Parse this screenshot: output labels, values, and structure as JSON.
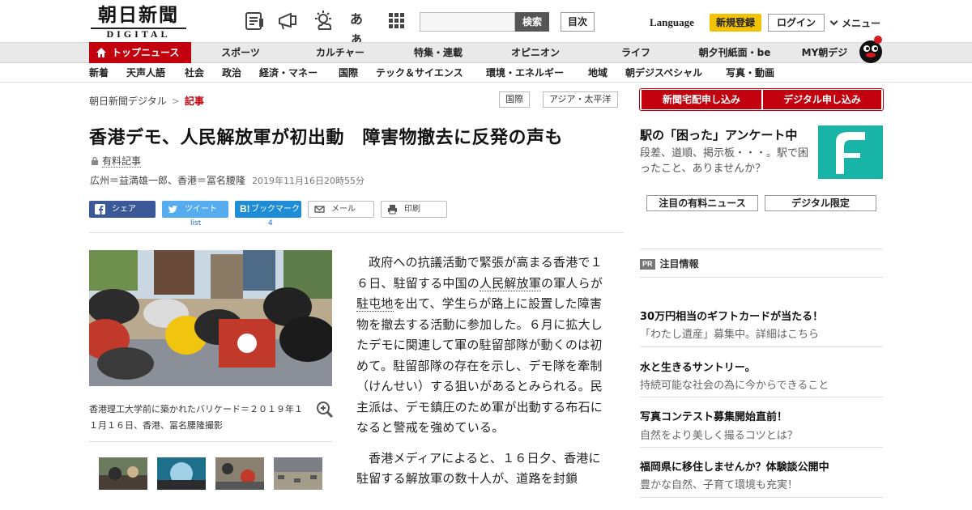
{
  "header": {
    "logo_ja": "朝日新聞",
    "logo_en": "DIGITAL",
    "search_placeholder": "",
    "search_button": "検索",
    "toc_button": "目次",
    "language": "Language",
    "register": "新規登録",
    "login": "ログイン",
    "menu": "メニュー",
    "icons": [
      "newspaper-icon",
      "megaphone-icon",
      "weather-icon",
      "font-size-icon",
      "grid-icon"
    ],
    "font_size_label": "あぁ"
  },
  "nav_primary": {
    "top_news": "トップニュース",
    "items": [
      "スポーツ",
      "カルチャー",
      "特集・連載",
      "オピニオン",
      "ライフ",
      "朝夕刊紙面・be",
      "MY朝デジ"
    ]
  },
  "nav_secondary": {
    "items": [
      "新着",
      "天声人語",
      "社会",
      "政治",
      "経済・マネー",
      "国際",
      "テック＆サイエンス",
      "環境・エネルギー",
      "地域",
      "朝デジスペシャル",
      "写真・動画"
    ]
  },
  "breadcrumb": {
    "home": "朝日新聞デジタル",
    "sep": ">",
    "current": "記事"
  },
  "tags": [
    "国際",
    "アジア・太平洋"
  ],
  "article": {
    "title": "香港デモ、人民解放軍が初出動　障害物撤去に反発の声も",
    "paid_label": "有料記事",
    "authors": "広州＝益満雄一郎、香港＝冨名腰隆",
    "date": "2019年11月16日20時55分",
    "share": {
      "facebook": "シェア",
      "twitter": "ツイート",
      "hatena": "ブックマーク",
      "mail": "メール",
      "print": "印刷",
      "twitter_count": "list",
      "hatena_count": "4"
    },
    "photo_caption": "香港理工大学前に築かれたバリケード＝２０１９年１１月１６日、香港、冨名腰隆撮影",
    "p1_a": "政府への抗議活動で緊張が高まる香港で１６日、駐留する中国の",
    "p1_link1": "人民解放軍",
    "p1_b": "の軍人らが",
    "p1_link2": "駐屯地",
    "p1_c": "を出て、学生らが路上に設置した障害物を撤去する活動に参加した。６月に拡大したデモに関連して軍の駐留部隊が動くのは初めて。駐留部隊の存在を示し、デモ隊を牽制（けんせい）する狙いがあるとみられる。民主派は、デモ鎮圧のため軍が出動する布石になると警戒を強めている。",
    "p2": "香港メディアによると、１６日夕、香港に駐留する解放軍の数十人が、道路を封鎖"
  },
  "sidebar": {
    "button_home_delivery": "新聞宅配申し込み",
    "button_digital": "デジタル申し込み",
    "survey_title": "駅の「困った」アンケート中",
    "survey_text": "段差、道順、掲示板・・・。駅で困ったこと、ありませんか？",
    "pill_paid_news": "注目の有料ニュース",
    "pill_digital_only": "デジタル限定",
    "pr_label": "PR",
    "pr_heading": "注目情報",
    "promos": [
      {
        "title": "30万円相当のギフトカードが当たる！",
        "sub": "「わたし遺産」募集中。詳細はこちら"
      },
      {
        "title": "水と生きるサントリー。",
        "sub": "持続可能な社会の為に今からできること"
      },
      {
        "title": "写真コンテスト募集開始直前！",
        "sub": "自然をより美しく撮るコツとは？"
      },
      {
        "title": "福岡県に移住しませんか？体験談公開中",
        "sub": "豊かな自然、子育て環境も充実！"
      }
    ]
  },
  "colors": {
    "brand_red": "#c3000d",
    "register_yellow": "#f2c200",
    "facebook": "#3b5998",
    "twitter": "#55acee",
    "hatena": "#1f8dd6",
    "survey_teal": "#17b4a7"
  }
}
